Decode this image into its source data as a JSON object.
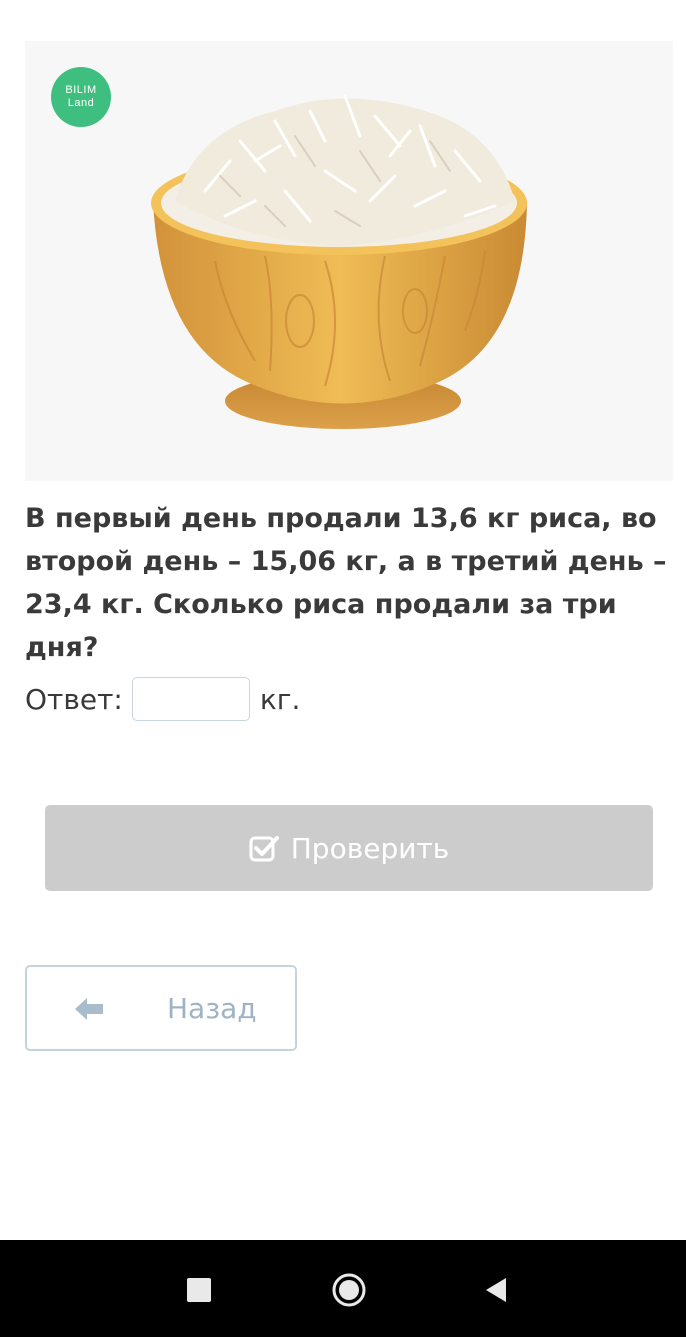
{
  "logo": {
    "line1": "BILIM",
    "line2": "Land"
  },
  "question": "В первый день продали 13,6 кг риса, во второй день – 15,06 кг, а в третий день – 23,4 кг. Сколько риса продали за три дня?",
  "answer": {
    "label": "Ответ:",
    "value": "",
    "unit": "кг."
  },
  "check_button": {
    "label": "Проверить",
    "icon": "checkbox-check-icon"
  },
  "back_button": {
    "label": "Назад",
    "icon": "arrow-left-icon"
  },
  "navbar": {
    "recent_icon": "square-icon",
    "home_icon": "circle-home-icon",
    "back_icon": "triangle-back-icon"
  },
  "colors": {
    "logo": "#3fbf7f",
    "button_disabled": "#cccccc",
    "back_text": "#9fb3c4",
    "bowl": "#e0a845"
  }
}
